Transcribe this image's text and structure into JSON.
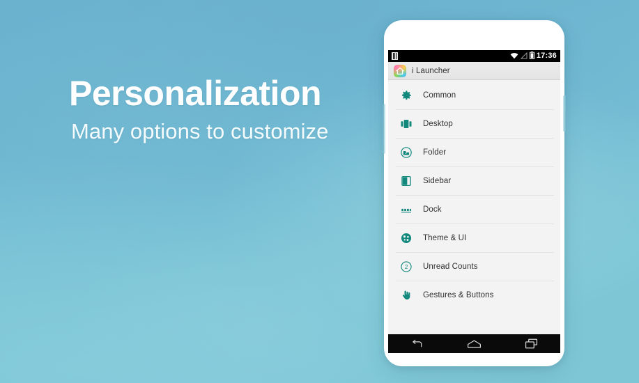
{
  "promo": {
    "headline": "Personalization",
    "subhead": "Many options to customize",
    "headline_color": "#ffffff",
    "background_color": "#74bdd3"
  },
  "phone": {
    "status_bar": {
      "clock": "17:36",
      "sim_icon": "sim-card-icon",
      "wifi_icon": "wifi-icon",
      "signal_icon": "signal-icon",
      "battery_icon": "battery-icon"
    },
    "app_header": {
      "icon": "i-launcher-app-icon",
      "title": "i Launcher"
    },
    "settings_list": [
      {
        "icon": "gear-icon",
        "label": "Common"
      },
      {
        "icon": "desktop-screens-icon",
        "label": "Desktop"
      },
      {
        "icon": "folder-icon",
        "label": "Folder"
      },
      {
        "icon": "sidebar-icon",
        "label": "Sidebar"
      },
      {
        "icon": "dock-icon",
        "label": "Dock"
      },
      {
        "icon": "theme-palette-icon",
        "label": "Theme & UI"
      },
      {
        "icon": "unread-badge-icon",
        "label": "Unread Counts"
      },
      {
        "icon": "hand-gesture-icon",
        "label": "Gestures & Buttons"
      }
    ],
    "nav_bar": {
      "back": "back-icon",
      "home": "home-icon",
      "recents": "recents-icon"
    },
    "accent_color": "#13897d"
  }
}
